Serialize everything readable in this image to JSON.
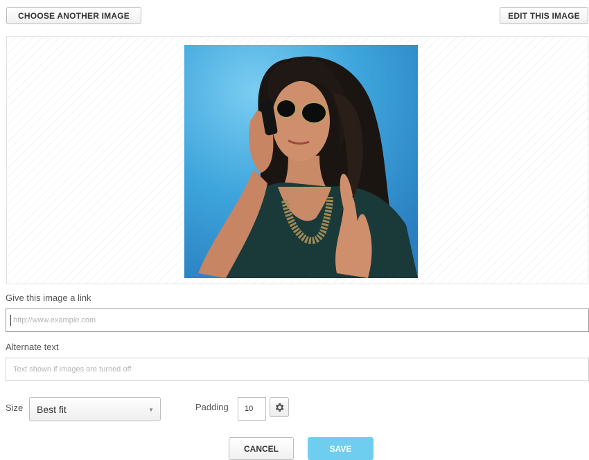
{
  "toolbar": {
    "choose_label": "CHOOSE ANOTHER IMAGE",
    "edit_label": "EDIT THIS IMAGE"
  },
  "preview": {
    "image": "woman-on-phone-photo"
  },
  "link": {
    "label": "Give this image a link",
    "placeholder": "http://www.example.com",
    "value": ""
  },
  "alt": {
    "label": "Alternate text",
    "placeholder": "Text shown if images are turned off",
    "value": ""
  },
  "size": {
    "label": "Size",
    "selected": "Best fit"
  },
  "padding": {
    "label": "Padding",
    "value": "10",
    "settings_icon": "gear-icon"
  },
  "actions": {
    "cancel_label": "CANCEL",
    "save_label": "SAVE"
  },
  "colors": {
    "save_accent": "#6fcdf0"
  }
}
